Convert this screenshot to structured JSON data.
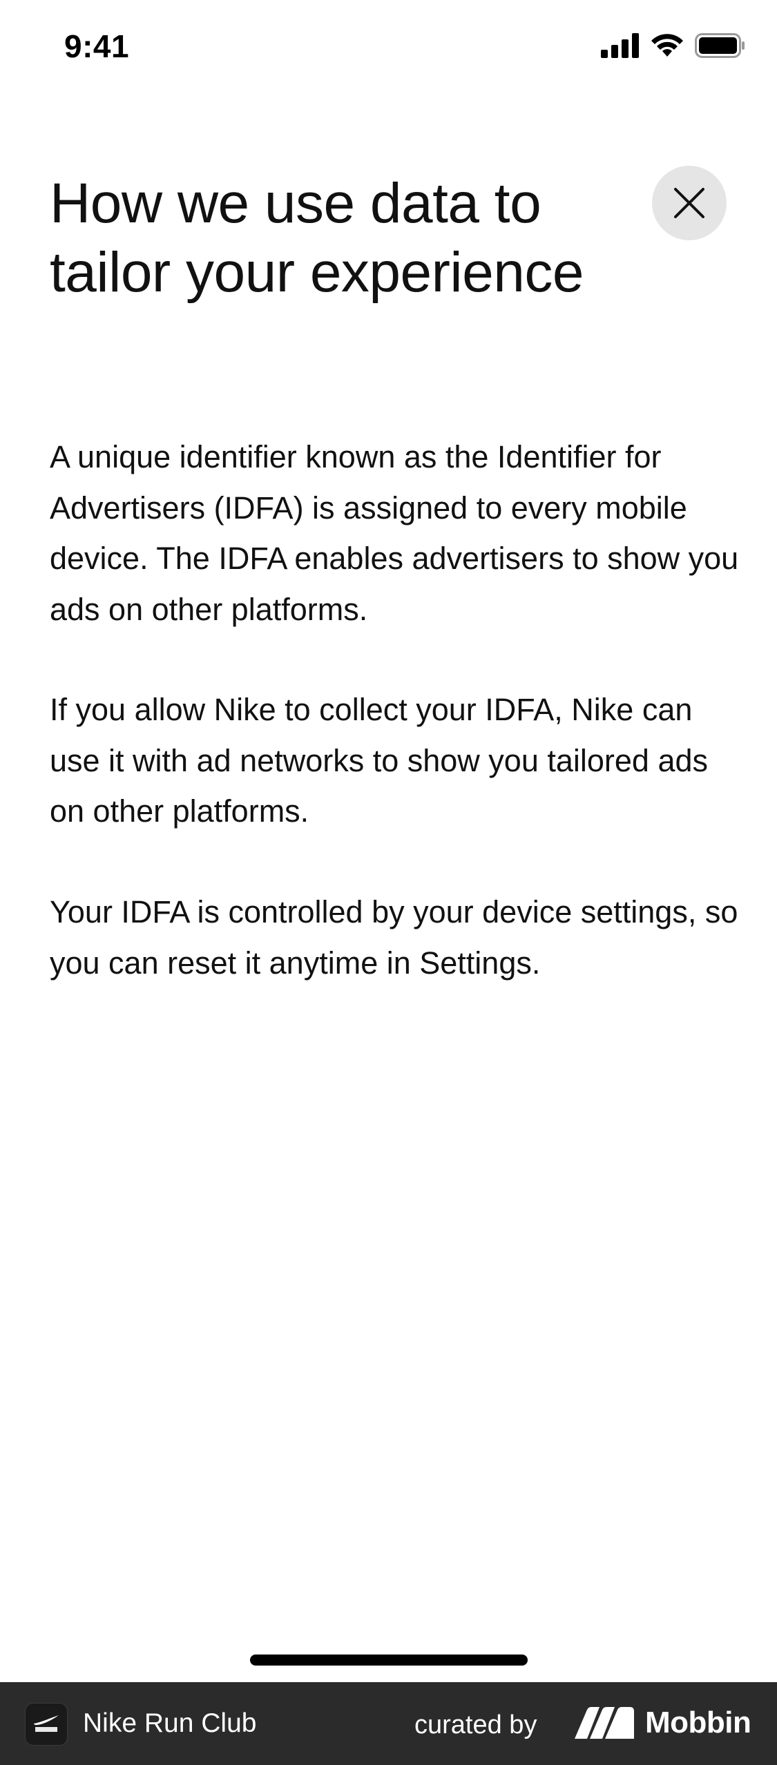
{
  "status_bar": {
    "time": "9:41"
  },
  "header": {
    "title": "How we use data to tailor your experience",
    "close_icon": "close-icon"
  },
  "content": {
    "paragraphs": [
      "A unique identifier known as the Identifier for Advertisers (IDFA) is assigned to every mobile device. The IDFA enables advertisers to show you ads on other platforms.",
      "If you allow Nike to collect your IDFA, Nike can use it with ad networks to show you tailored ads on other platforms.",
      "Your IDFA is controlled by your device settings, so you can reset it anytime in Settings."
    ]
  },
  "footer": {
    "app_name": "Nike Run Club",
    "curated_label": "curated by",
    "brand": "Mobbin"
  },
  "colors": {
    "background": "#ffffff",
    "text": "#111111",
    "close_button_bg": "#e5e5e5",
    "footer_bg": "#2b2b2b"
  }
}
